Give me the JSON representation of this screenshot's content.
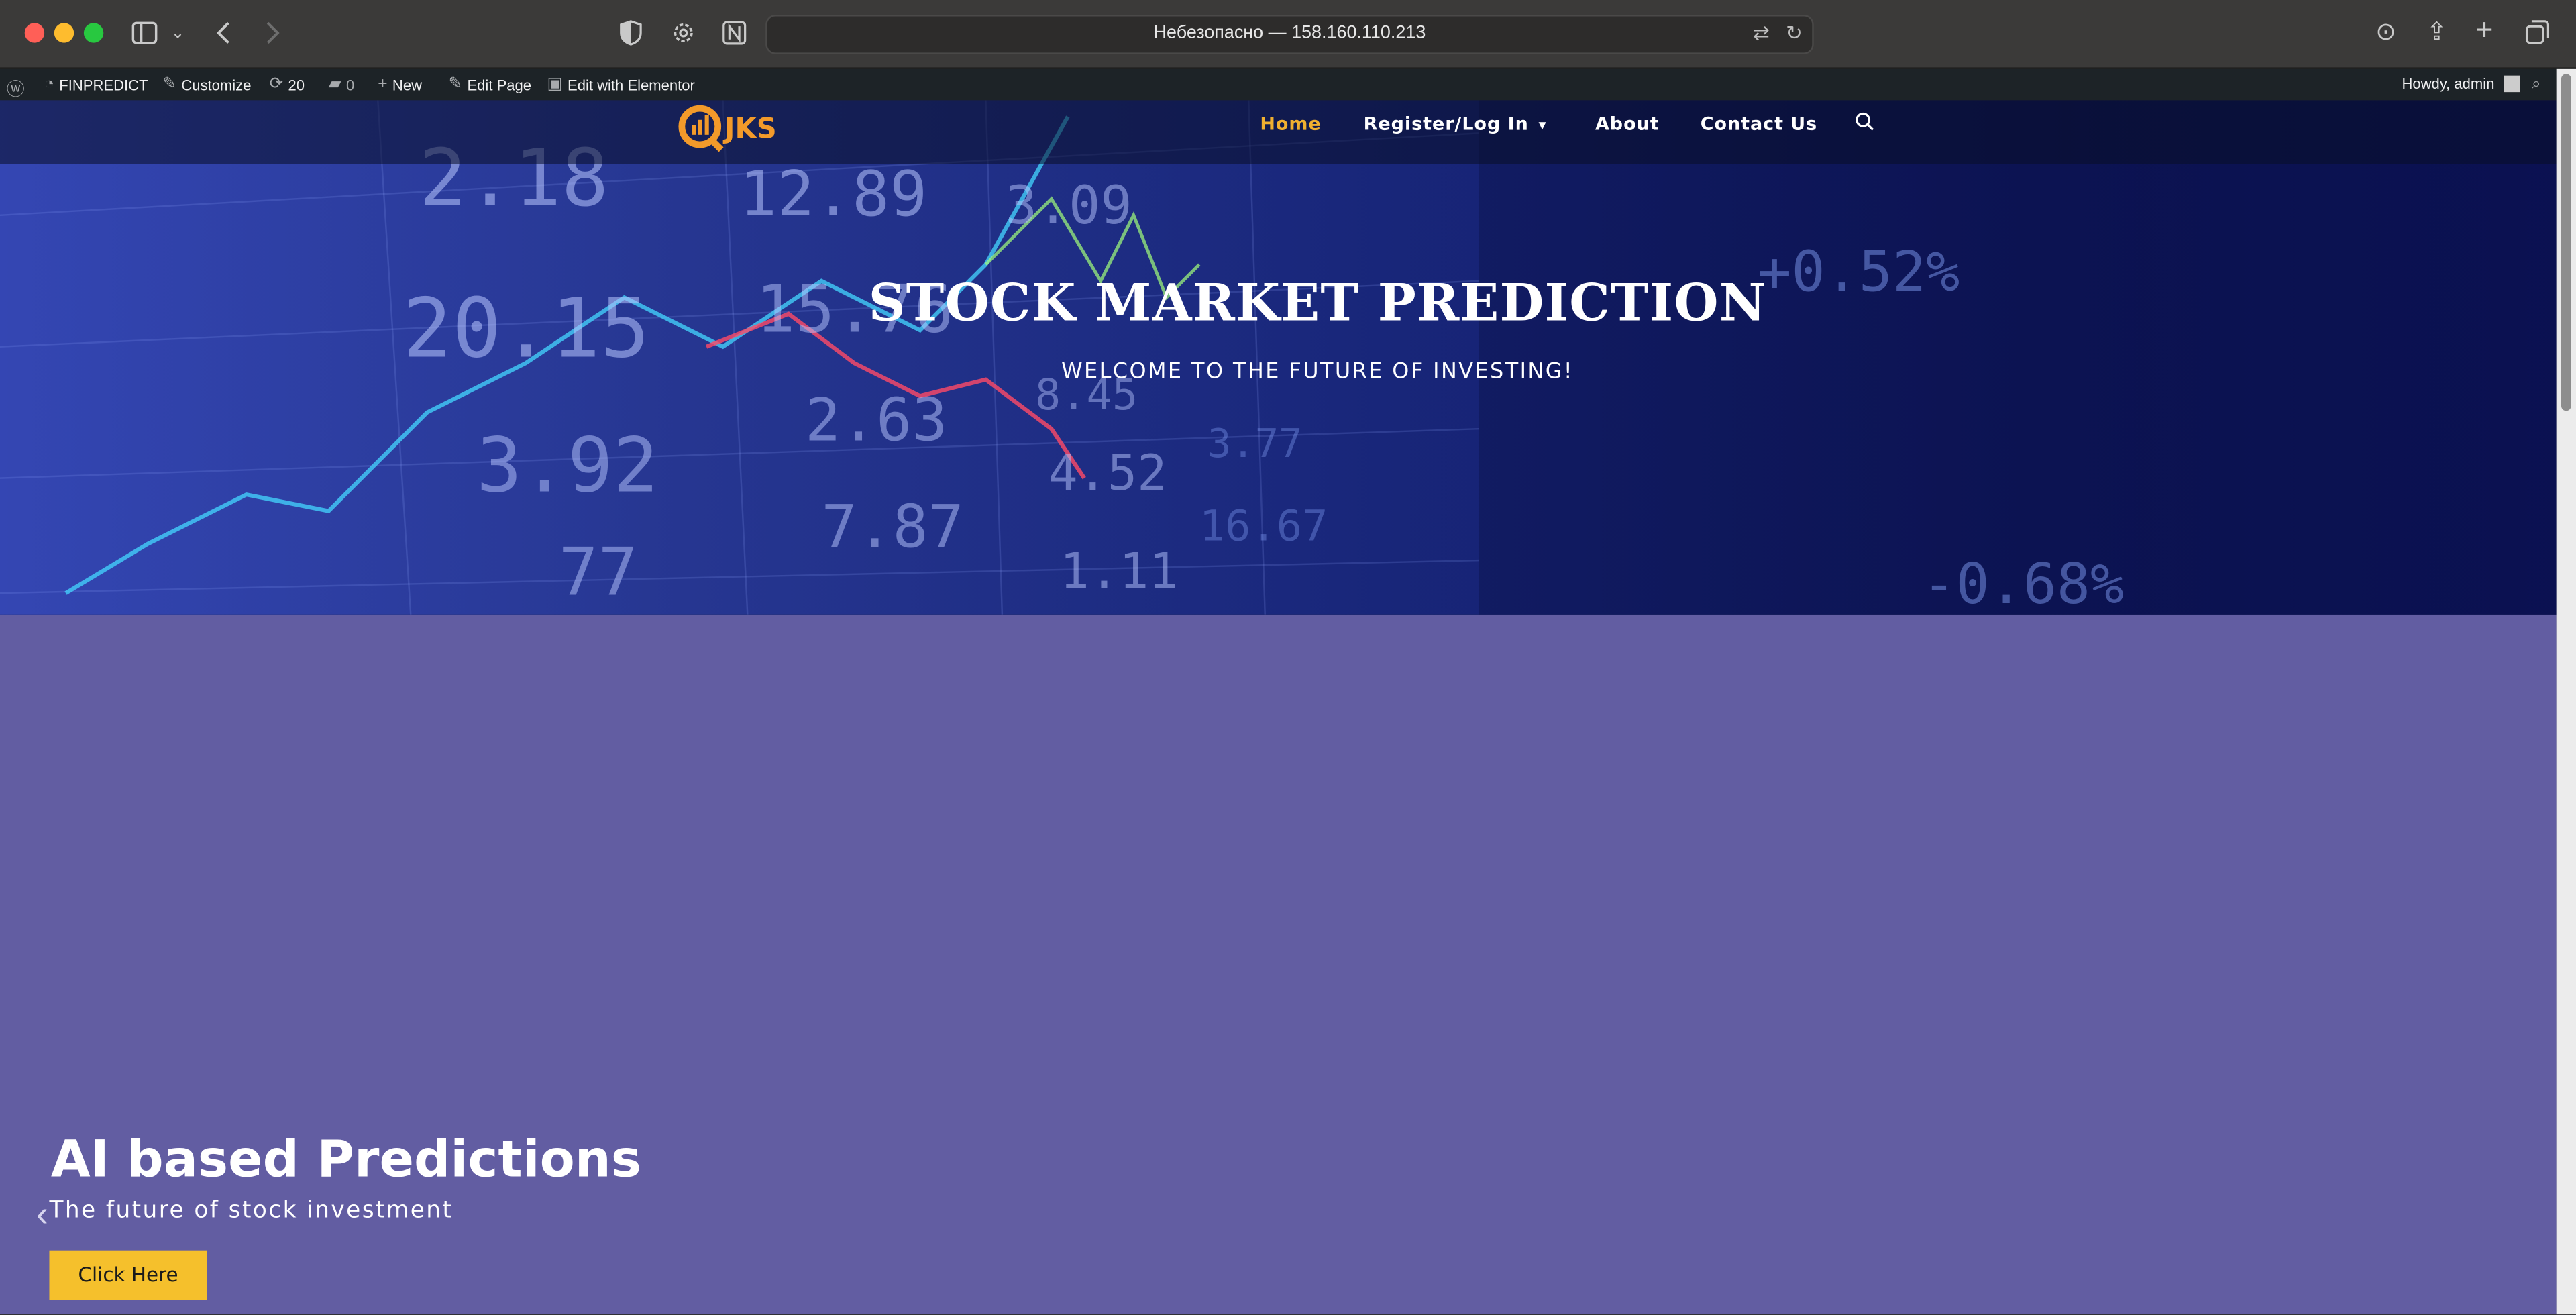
{
  "browser": {
    "url": "Небезопасно — 158.160.110.213"
  },
  "admin_bar": {
    "site_name": "FINPREDICT",
    "customize": "Customize",
    "updates_count": "20",
    "comments_count": "0",
    "new": "New",
    "edit_page": "Edit Page",
    "edit_elementor": "Edit with Elementor",
    "howdy": "Howdy, admin"
  },
  "site": {
    "logo_text": "JKS",
    "nav": {
      "home": "Home",
      "register": "Register/Log In",
      "about": "About",
      "contact": "Contact Us"
    }
  },
  "hero": {
    "title": "STOCK MARKET PREDICTION",
    "subtitle": "WELCOME TO THE FUTURE OF INVESTING!",
    "ticker_numbers": [
      "2.18",
      "12.89",
      "3.09",
      "20.15",
      "15.76",
      "+0.52%",
      "2.63",
      "3.92",
      "7.87",
      "4.52",
      "1.11",
      "-0.68%",
      "8.45",
      "77",
      "16.67",
      "3.77"
    ]
  },
  "slider": {
    "title": "AI based Predictions",
    "subtitle": "The future of stock investment",
    "button": "Click Here"
  },
  "colors": {
    "accent": "#f0b030",
    "slider_bg": "#625da2",
    "button": "#f5c02c"
  }
}
